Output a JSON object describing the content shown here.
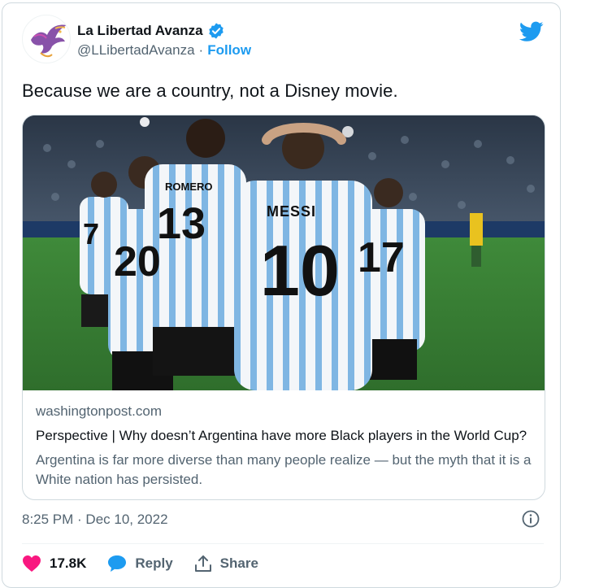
{
  "account": {
    "display_name": "La Libertad Avanza",
    "handle": "@LLibertadAvanza",
    "separator": "·",
    "follow_label": "Follow"
  },
  "tweet": {
    "text": "Because we are a country, not a Disney movie."
  },
  "link_card": {
    "domain": "washingtonpost.com",
    "title": "Perspective | Why doesn’t Argentina have more Black players in the World Cup?",
    "description": "Argentina is far more diverse than many people realize — but the myth that it is a White nation has persisted.",
    "image_jersey_names": [
      "ROMERO",
      "MESSI"
    ],
    "image_jersey_numbers": [
      "13",
      "10",
      "20",
      "7",
      "17"
    ]
  },
  "timestamp": "8:25 PM · Dec 10, 2022",
  "actions": {
    "like_count": "17.8K",
    "reply_label": "Reply",
    "share_label": "Share"
  },
  "colors": {
    "accent": "#1d9bf0",
    "like": "#f91880",
    "text_primary": "#0f1419",
    "text_secondary": "#536471"
  },
  "icons": {
    "verified": "verified-badge-icon",
    "brand": "twitter-bird-icon",
    "info": "info-icon",
    "like": "heart-icon",
    "reply": "speech-bubble-icon",
    "share": "share-upload-icon"
  }
}
